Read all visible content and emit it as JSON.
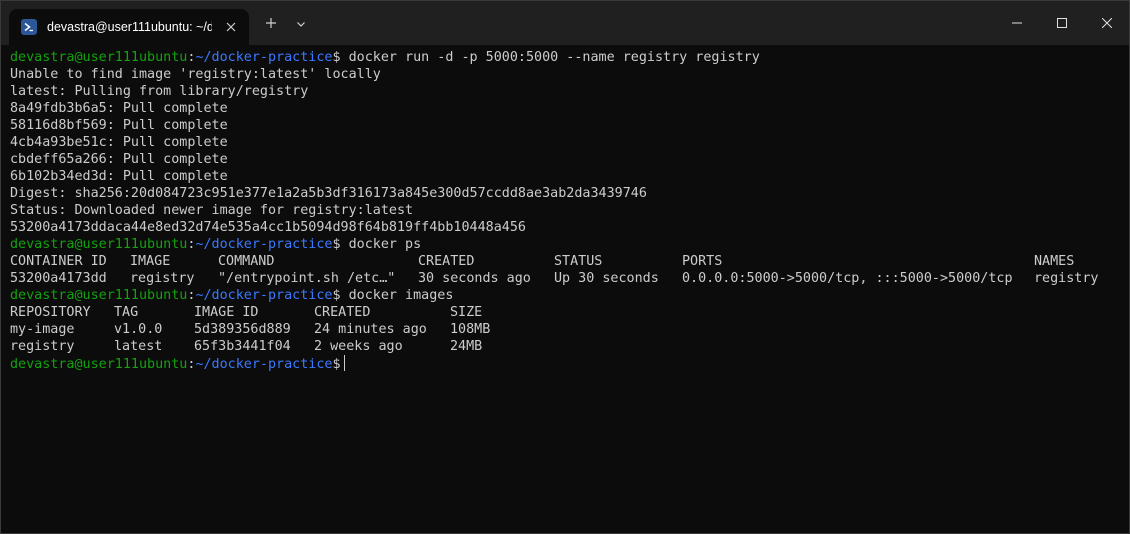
{
  "window": {
    "tab_title": "devastra@user111ubuntu: ~/dc",
    "new_tab_label": "+"
  },
  "prompt": {
    "user_host": "devastra@user111ubuntu",
    "sep": ":",
    "path": "~/docker-practice",
    "symbol": "$"
  },
  "session": {
    "cmd1": " docker run -d -p 5000:5000 --name registry registry",
    "out1": [
      "Unable to find image 'registry:latest' locally",
      "latest: Pulling from library/registry",
      "8a49fdb3b6a5: Pull complete",
      "58116d8bf569: Pull complete",
      "4cb4a93be51c: Pull complete",
      "cbdeff65a266: Pull complete",
      "6b102b34ed3d: Pull complete",
      "Digest: sha256:20d084723c951e377e1a2a5b3df316173a845e300d57ccdd8ae3ab2da3439746",
      "Status: Downloaded newer image for registry:latest",
      "53200a4173ddaca44e8ed32d74e535a4cc1b5094d98f64b819ff4bb10448a456"
    ],
    "cmd2": " docker ps",
    "ps_table": {
      "headers": [
        "CONTAINER ID",
        "IMAGE",
        "COMMAND",
        "CREATED",
        "STATUS",
        "PORTS",
        "NAMES"
      ],
      "rows": [
        [
          "53200a4173dd",
          "registry",
          "\"/entrypoint.sh /etc…\"",
          "30 seconds ago",
          "Up 30 seconds",
          "0.0.0.0:5000->5000/tcp, :::5000->5000/tcp",
          "registry"
        ]
      ]
    },
    "cmd3": " docker images",
    "images_table": {
      "headers": [
        "REPOSITORY",
        "TAG",
        "IMAGE ID",
        "CREATED",
        "SIZE"
      ],
      "rows": [
        [
          "my-image",
          "v1.0.0",
          "5d389356d889",
          "24 minutes ago",
          "108MB"
        ],
        [
          "registry",
          "latest",
          "65f3b3441f04",
          "2 weeks ago",
          "24MB"
        ]
      ]
    }
  },
  "colors": {
    "background": "#0c0c0c",
    "titlebar": "#202020",
    "text": "#cccccc",
    "prompt_user": "#13a10e",
    "prompt_path": "#3b78ff"
  },
  "icons": {
    "tab_icon": "powershell-icon",
    "tab_close": "close-icon",
    "new_tab": "plus-icon",
    "dropdown": "chevron-down-icon",
    "minimize": "minimize-icon",
    "maximize": "maximize-icon",
    "close": "close-icon"
  }
}
